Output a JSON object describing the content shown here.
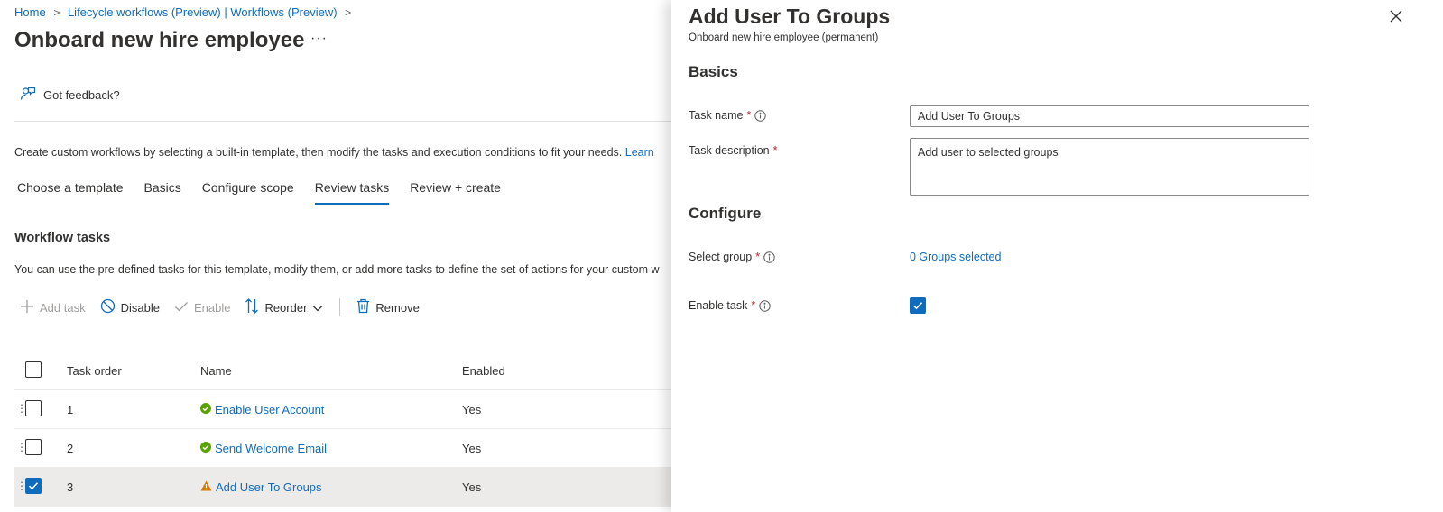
{
  "breadcrumb": {
    "home": "Home",
    "lifecycle": "Lifecycle workflows (Preview) | Workflows (Preview)"
  },
  "page": {
    "title": "Onboard new hire employee",
    "more_label": "···",
    "feedback_label": "Got feedback?",
    "description": "Create custom workflows by selecting a built-in template, then modify the tasks and execution conditions to fit your needs.",
    "learn_more": "Learn"
  },
  "tabs": [
    {
      "label": "Choose a template",
      "active": false
    },
    {
      "label": "Basics",
      "active": false
    },
    {
      "label": "Configure scope",
      "active": false
    },
    {
      "label": "Review tasks",
      "active": true
    },
    {
      "label": "Review + create",
      "active": false
    }
  ],
  "workflow": {
    "title": "Workflow tasks",
    "description": "You can use the pre-defined tasks for this template, modify them, or add more tasks to define the set of actions for your custom w"
  },
  "toolbar": {
    "add_task": "Add task",
    "disable": "Disable",
    "enable": "Enable",
    "reorder": "Reorder",
    "remove": "Remove"
  },
  "table": {
    "columns": {
      "order": "Task order",
      "name": "Name",
      "enabled": "Enabled"
    },
    "rows": [
      {
        "order": "1",
        "name": "Enable User Account",
        "enabled": "Yes",
        "status": "success",
        "selected": false
      },
      {
        "order": "2",
        "name": "Send Welcome Email",
        "enabled": "Yes",
        "status": "success",
        "selected": false
      },
      {
        "order": "3",
        "name": "Add User To Groups",
        "enabled": "Yes",
        "status": "warning",
        "selected": true
      }
    ]
  },
  "panel": {
    "title": "Add User To Groups",
    "subtitle": "Onboard new hire employee (permanent)",
    "basics_heading": "Basics",
    "task_name_label": "Task name",
    "task_name_value": "Add User To Groups",
    "task_description_label": "Task description",
    "task_description_value": "Add user to selected groups",
    "configure_heading": "Configure",
    "select_group_label": "Select group",
    "groups_selected": "0 Groups selected",
    "enable_task_label": "Enable task",
    "enable_task_checked": true,
    "required_mark": "*"
  },
  "colors": {
    "accent": "#0f6cbd",
    "success": "#57a300",
    "warning": "#d87a00",
    "required": "#a4262c"
  },
  "icons": {
    "close": "close-icon",
    "info": "info-icon",
    "feedback": "feedback-icon",
    "success": "success-check-icon",
    "warning": "warning-icon"
  }
}
